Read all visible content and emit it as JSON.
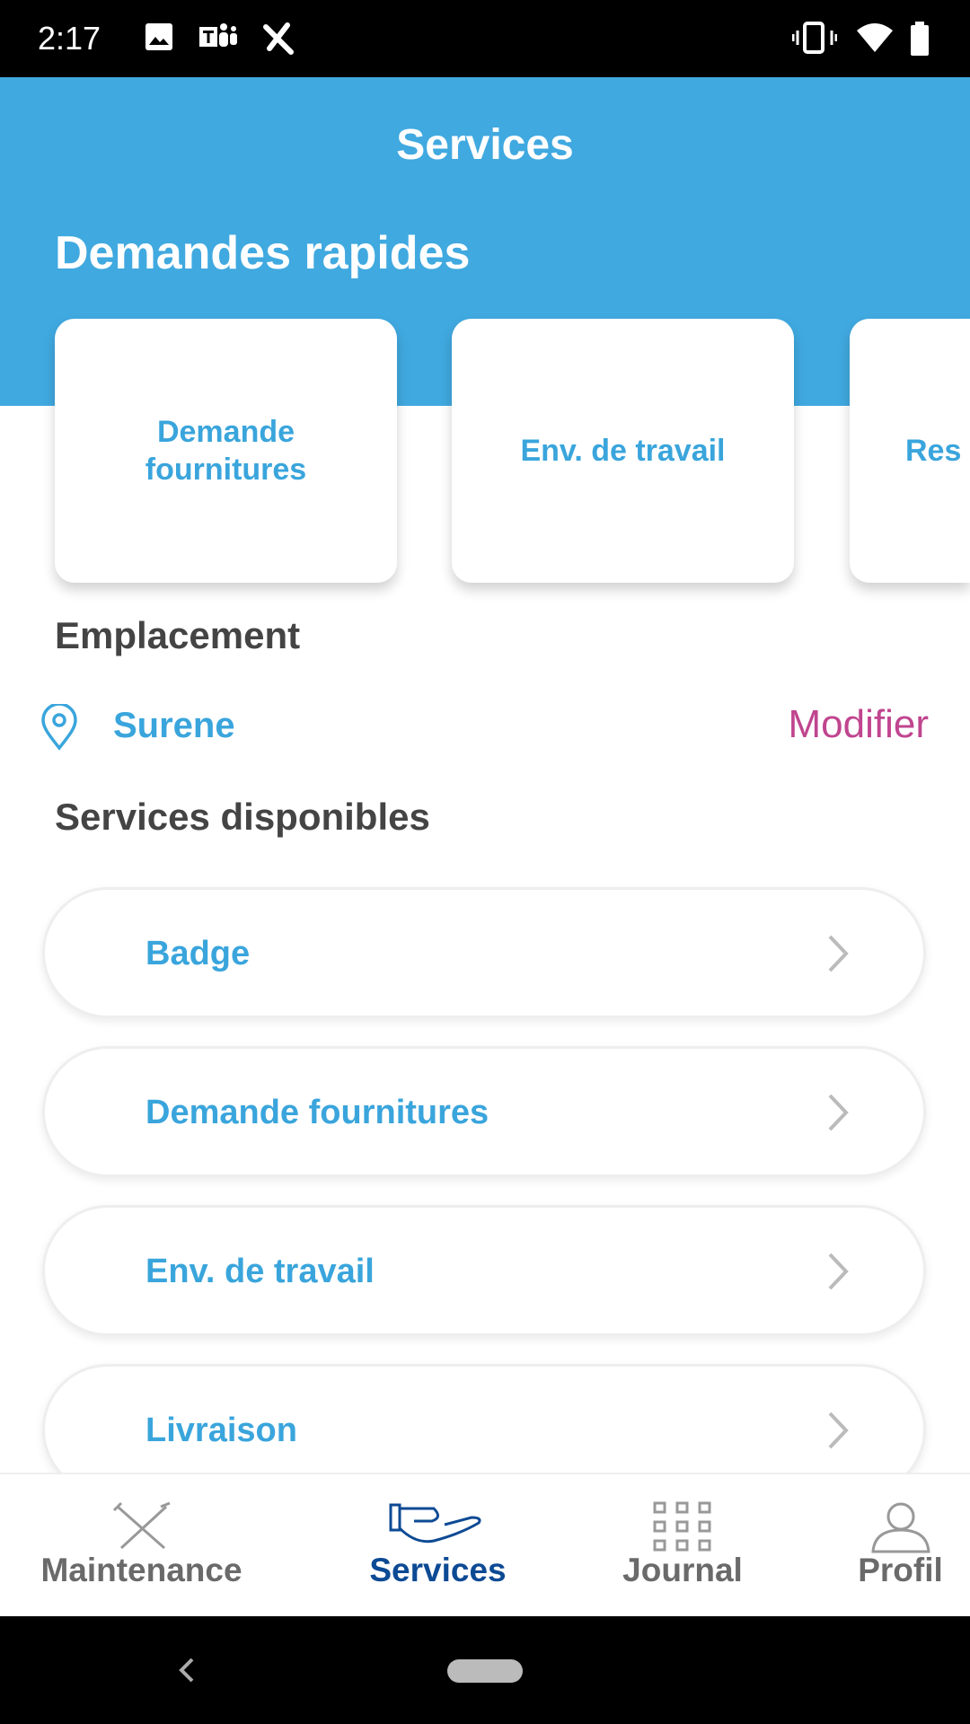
{
  "status_bar": {
    "time": "2:17",
    "icons": [
      "image-icon",
      "teams-icon",
      "wrench-icon",
      "vibrate-icon",
      "wifi-icon",
      "battery-icon"
    ]
  },
  "header": {
    "title": "Services",
    "quick_title": "Demandes rapides"
  },
  "quick_requests": [
    {
      "label": "Demande fournitures"
    },
    {
      "label": "Env. de travail"
    },
    {
      "label": "Res"
    }
  ],
  "location": {
    "heading": "Emplacement",
    "name": "Surene",
    "modify": "Modifier"
  },
  "services": {
    "heading": "Services disponibles",
    "items": [
      {
        "label": "Badge"
      },
      {
        "label": "Demande fournitures"
      },
      {
        "label": "Env. de travail"
      },
      {
        "label": "Livraison"
      }
    ]
  },
  "bottom_nav": {
    "items": [
      {
        "label": "Maintenance",
        "icon": "tools-icon"
      },
      {
        "label": "Services",
        "icon": "hand-icon",
        "active": true
      },
      {
        "label": "Journal",
        "icon": "grid-icon"
      },
      {
        "label": "Profil",
        "icon": "person-icon"
      }
    ]
  },
  "colors": {
    "primary": "#40a9e0",
    "accent": "#c0458f",
    "nav_active": "#0d4a94"
  }
}
